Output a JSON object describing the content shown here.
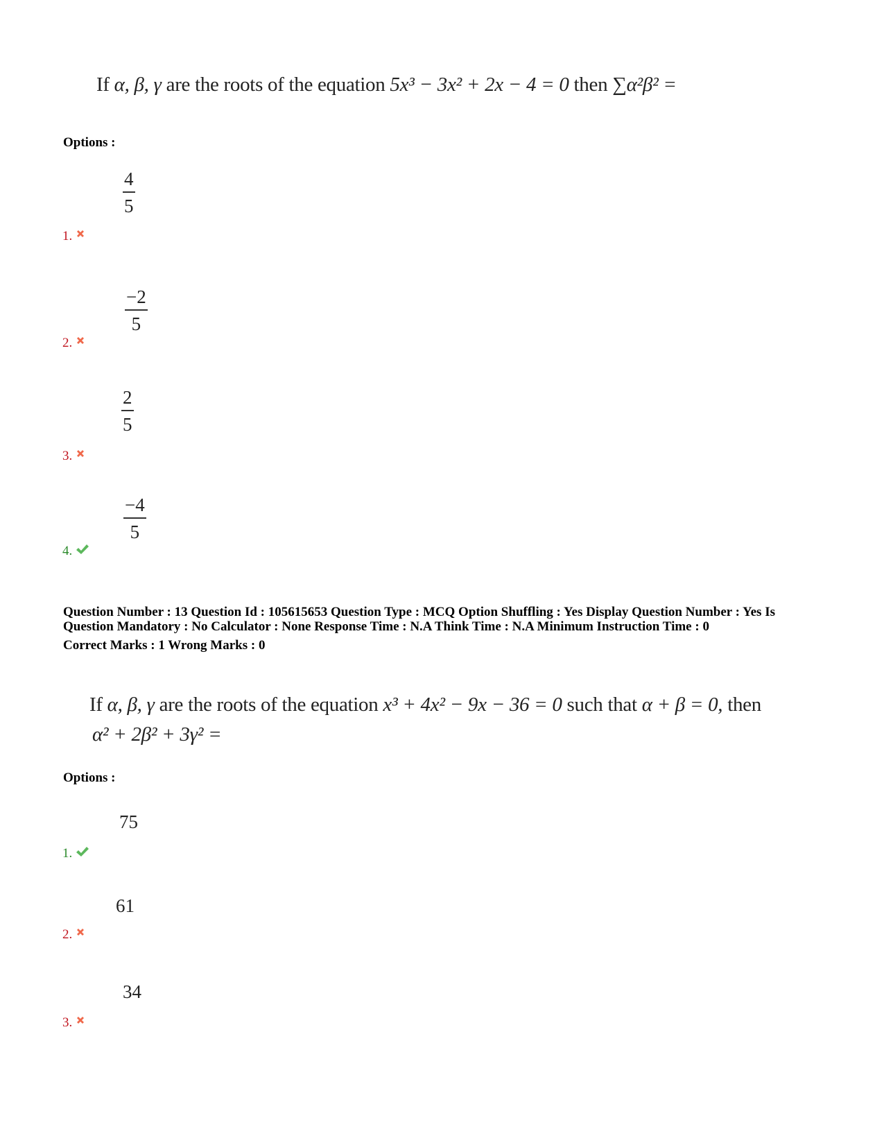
{
  "questions": [
    {
      "text": {
        "prefix": "If",
        "vars": "α, β, γ",
        "mid": "are the roots of the equation",
        "equation": "5x³ − 3x² + 2x − 4 = 0",
        "then": "then",
        "expression": "∑α²β² ="
      },
      "options_label": "Options :",
      "options": [
        {
          "number": "1.",
          "numerator": "4",
          "denominator": "5",
          "status": "wrong",
          "icon": "cross-icon"
        },
        {
          "number": "2.",
          "numerator": "−2",
          "denominator": "5",
          "status": "wrong",
          "icon": "cross-icon"
        },
        {
          "number": "3.",
          "numerator": "2",
          "denominator": "5",
          "status": "wrong",
          "icon": "cross-icon"
        },
        {
          "number": "4.",
          "numerator": "−4",
          "denominator": "5",
          "status": "correct",
          "icon": "check-icon"
        }
      ]
    },
    {
      "meta": {
        "line1": "Question Number : 13 Question Id : 105615653 Question Type : MCQ Option Shuffling : Yes Display Question Number : Yes Is",
        "line2": "Question Mandatory : No Calculator : None Response Time : N.A Think Time : N.A Minimum Instruction Time : 0",
        "line3": "Correct Marks : 1 Wrong Marks : 0"
      },
      "text": {
        "line1_prefix": "If",
        "vars": "α, β, γ",
        "mid": "are the roots of the equation",
        "equation": "x³ + 4x² − 9x − 36 = 0",
        "condition_prefix": "such that",
        "condition": "α + β = 0,",
        "then": "then",
        "line2": "α² + 2β² + 3γ² ="
      },
      "options_label": "Options :",
      "options": [
        {
          "number": "1.",
          "value": "75",
          "status": "correct",
          "icon": "check-icon"
        },
        {
          "number": "2.",
          "value": "61",
          "status": "wrong",
          "icon": "cross-icon"
        },
        {
          "number": "3.",
          "value": "34",
          "status": "wrong",
          "icon": "cross-icon"
        }
      ]
    }
  ],
  "colors": {
    "correct": "#2b8a2b",
    "wrong": "#c0141e",
    "cross_icon": "#f0684a",
    "check_icon": "#5cb85c"
  }
}
